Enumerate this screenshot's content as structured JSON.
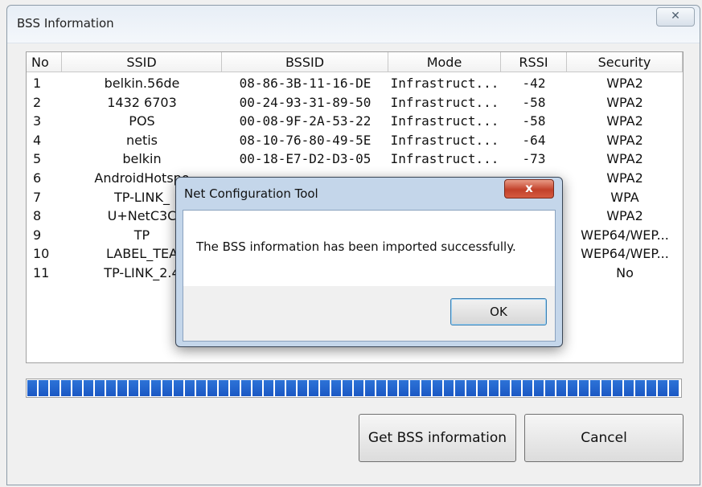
{
  "window": {
    "title": "BSS Information",
    "close_glyph": "✕"
  },
  "table": {
    "columns": [
      "No",
      "SSID",
      "BSSID",
      "Mode",
      "RSSI",
      "Security"
    ],
    "rows": [
      {
        "no": "1",
        "ssid": "belkin.56de",
        "bssid": "08-86-3B-11-16-DE",
        "mode": "Infrastruct...",
        "rssi": "-42",
        "security": "WPA2"
      },
      {
        "no": "2",
        "ssid": "1432 6703",
        "bssid": "00-24-93-31-89-50",
        "mode": "Infrastruct...",
        "rssi": "-58",
        "security": "WPA2"
      },
      {
        "no": "3",
        "ssid": "POS",
        "bssid": "00-08-9F-2A-53-22",
        "mode": "Infrastruct...",
        "rssi": "-58",
        "security": "WPA2"
      },
      {
        "no": "4",
        "ssid": "netis",
        "bssid": "08-10-76-80-49-5E",
        "mode": "Infrastruct...",
        "rssi": "-64",
        "security": "WPA2"
      },
      {
        "no": "5",
        "ssid": "belkin",
        "bssid": "00-18-E7-D2-D3-05",
        "mode": "Infrastruct...",
        "rssi": "-73",
        "security": "WPA2"
      },
      {
        "no": "6",
        "ssid": "AndroidHotspo",
        "bssid": "",
        "mode": "",
        "rssi": "",
        "security": "WPA2"
      },
      {
        "no": "7",
        "ssid": "TP-LINK_",
        "bssid": "",
        "mode": "",
        "rssi": "",
        "security": "WPA"
      },
      {
        "no": "8",
        "ssid": "U+NetC3C",
        "bssid": "",
        "mode": "",
        "rssi": "",
        "security": "WPA2"
      },
      {
        "no": "9",
        "ssid": "TP",
        "bssid": "",
        "mode": "",
        "rssi": "",
        "security": "WEP64/WEP..."
      },
      {
        "no": "10",
        "ssid": "LABEL_TEA",
        "bssid": "",
        "mode": "",
        "rssi": "",
        "security": "WEP64/WEP..."
      },
      {
        "no": "11",
        "ssid": "TP-LINK_2.4",
        "bssid": "",
        "mode": "",
        "rssi": "",
        "security": "No"
      }
    ]
  },
  "progress": {
    "fraction": 1.0,
    "color": "#1f5fcc"
  },
  "buttons": {
    "get_bss": "Get BSS information",
    "cancel": "Cancel"
  },
  "dialog": {
    "title": "Net Configuration Tool",
    "close_glyph": "x",
    "message": "The BSS information has been imported successfully.",
    "ok": "OK"
  }
}
